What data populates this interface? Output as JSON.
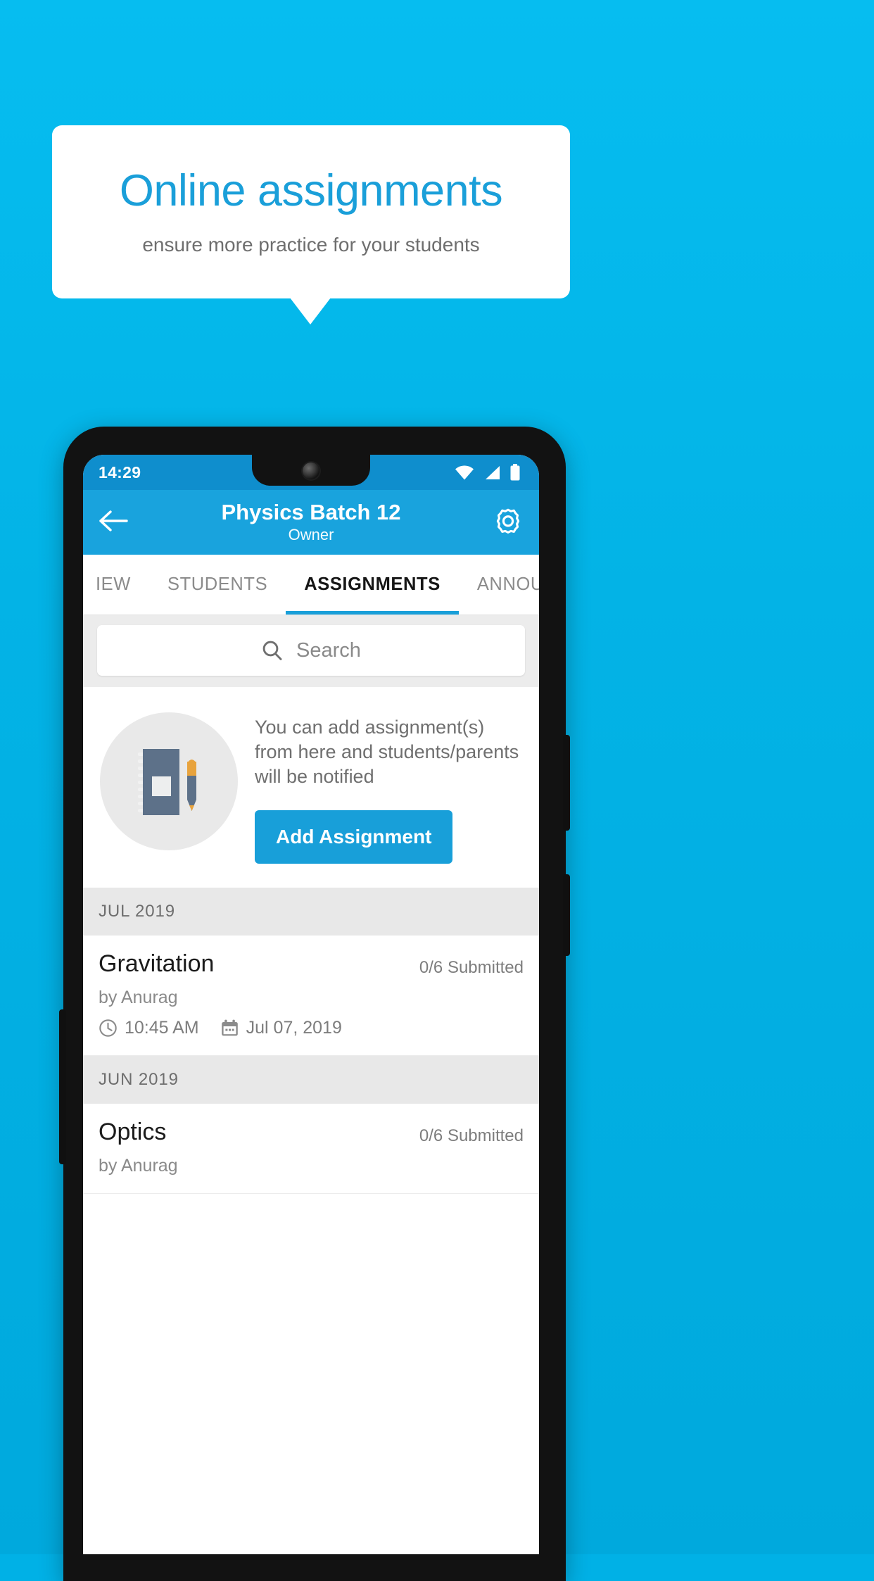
{
  "promo": {
    "title": "Online assignments",
    "subtitle": "ensure more practice for your students"
  },
  "colors": {
    "background": "#03b3e6",
    "accent": "#189fd9",
    "statusbar": "#0f8ecd",
    "appbar": "#19a3dd",
    "card": "#ffffff"
  },
  "phone": {
    "statusbar": {
      "time": "14:29",
      "icons": [
        "wifi-icon",
        "cellular-signal-icon",
        "battery-icon"
      ]
    },
    "appbar": {
      "back_icon": "back-arrow-icon",
      "title": "Physics Batch 12",
      "subtitle": "Owner",
      "settings_icon": "gear-icon"
    },
    "tabs": [
      {
        "label": "IEW",
        "active": false
      },
      {
        "label": "STUDENTS",
        "active": false
      },
      {
        "label": "ASSIGNMENTS",
        "active": true
      },
      {
        "label": "ANNOUNCEM",
        "active": false
      }
    ],
    "search": {
      "icon": "search-icon",
      "placeholder": "Search",
      "value": ""
    },
    "empty_state": {
      "illustration": "notebook-and-pen-icon",
      "message": "You can add assignment(s) from here and students/parents will be notified",
      "button_label": "Add Assignment"
    },
    "groups": [
      {
        "month": "JUL 2019",
        "items": [
          {
            "title": "Gravitation",
            "submitted": "0/6 Submitted",
            "author": "by Anurag",
            "time_icon": "clock-icon",
            "time": "10:45 AM",
            "date_icon": "calendar-icon",
            "date": "Jul 07, 2019"
          }
        ]
      },
      {
        "month": "JUN 2019",
        "items": [
          {
            "title": "Optics",
            "submitted": "0/6 Submitted",
            "author": "by Anurag",
            "time_icon": "clock-icon",
            "time": "",
            "date_icon": "calendar-icon",
            "date": ""
          }
        ]
      }
    ]
  }
}
